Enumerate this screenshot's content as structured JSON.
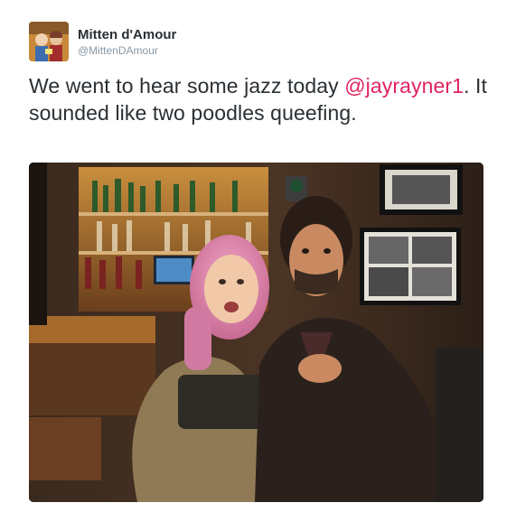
{
  "tweet": {
    "author": {
      "display_name": "Mitten d'Amour",
      "screen_name": "@MittenDAmour",
      "avatar_icon": "profile-avatar"
    },
    "text_before": "We went to hear some jazz today ",
    "mention": "@jayrayner1",
    "text_after": ". It sounded like two poodles queefing.",
    "photo": {
      "description_icon": "attached-photo",
      "accent": "#e0245e"
    }
  },
  "colors": {
    "text": "#292f33",
    "muted": "#8899a6",
    "link": "#e0245e"
  }
}
